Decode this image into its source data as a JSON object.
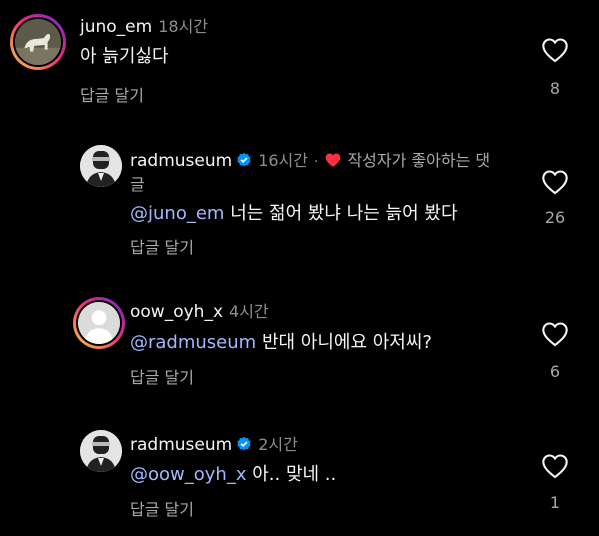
{
  "comments": [
    {
      "username": "juno_em",
      "time": "18시간",
      "text": "아 늙기싫다",
      "reply_label": "답글 달기",
      "likes": "8"
    },
    {
      "username": "radmuseum",
      "verified": true,
      "time": "16시간",
      "liked_by_author_line1": "작성자가 좋아하는 댓",
      "liked_by_author_line2": "글",
      "mention": "@juno_em",
      "text": "너는 젊어 봤냐 나는 늙어 봤다",
      "reply_label": "답글 달기",
      "likes": "26"
    },
    {
      "username": "oow_oyh_x",
      "time": "4시간",
      "mention": "@radmuseum",
      "text": "반대 아니에요 아저씨?",
      "reply_label": "답글 달기",
      "likes": "6"
    },
    {
      "username": "radmuseum",
      "verified": true,
      "time": "2시간",
      "mention": "@oow_oyh_x",
      "text": "아.. 맞네 ..",
      "reply_label": "답글 달기",
      "likes": "1"
    }
  ],
  "colors": {
    "background": "#000000",
    "mention": "#a6b7ff",
    "verified": "#0095f6",
    "heart_liked": "#ff3040",
    "muted": "#a8a8a8"
  }
}
